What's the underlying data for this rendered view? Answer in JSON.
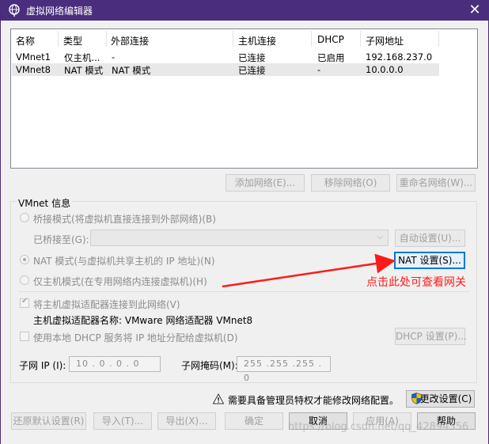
{
  "window": {
    "title": "虚拟网络编辑器",
    "close": "✕"
  },
  "list": {
    "headers": [
      "名称",
      "类型",
      "外部连接",
      "主机连接",
      "DHCP",
      "子网地址"
    ],
    "rows": [
      [
        "VMnet1",
        "仅主机...",
        "-",
        "已连接",
        "已启用",
        "192.168.237.0"
      ],
      [
        "VMnet8",
        "NAT 模式",
        "NAT 模式",
        "已连接",
        "-",
        "10.0.0.0"
      ]
    ]
  },
  "list_buttons": {
    "add": "添加网络(E)...",
    "remove": "移除网络(O)",
    "rename": "重命名网络(W)..."
  },
  "vmnet_info": {
    "title": "VMnet 信息",
    "bridge_mode": "桥接模式(将虚拟机直接连接到外部网络)(B)",
    "bridged_to": "已桥接至(G):",
    "auto_settings": "自动设置(U)...",
    "nat_mode": "NAT 模式(与虚拟机共享主机的 IP 地址)(N)",
    "nat_settings": "NAT 设置(S)...",
    "host_only": "仅主机模式(在专用网络内连接虚拟机)(H)",
    "connect_adapter": "将主机虚拟适配器连接到此网络(V)",
    "adapter_name": "主机虚拟适配器名称: VMware 网络适配器 VMnet8",
    "use_dhcp": "使用本地 DHCP 服务将 IP 地址分配给虚拟机(D)",
    "dhcp_settings": "DHCP 设置(P)...",
    "subnet_ip_label": "子网 IP (I):",
    "subnet_ip": "10 . 0 . 0 . 0",
    "subnet_mask_label": "子网掩码(M):",
    "subnet_mask": "255 .255 .255 . 0"
  },
  "admin_notice": "需要具备管理员特权才能修改网络配置。",
  "change_settings": "更改设置(C)",
  "bottom": {
    "restore": "还原默认设置(R)",
    "import": "导入(T)...",
    "export": "导出(X)...",
    "ok": "确定",
    "cancel": "取消",
    "apply": "应用(A)",
    "help": "帮助"
  },
  "annotation": "点击此处可查看网关",
  "watermark": "https://blog.csdn.net/qq_42894356",
  "colors": {
    "titlebar": "#4a2d7d",
    "annotation": "#ff1a1a",
    "focus": "#0078d7"
  }
}
